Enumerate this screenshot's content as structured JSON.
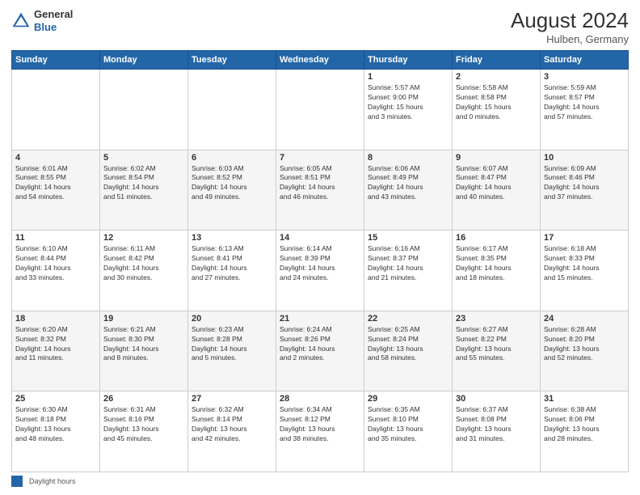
{
  "header": {
    "title": "August 2024",
    "location": "Hulben, Germany",
    "logo_general": "General",
    "logo_blue": "Blue"
  },
  "days_of_week": [
    "Sunday",
    "Monday",
    "Tuesday",
    "Wednesday",
    "Thursday",
    "Friday",
    "Saturday"
  ],
  "footer": {
    "legend_label": "Daylight hours"
  },
  "weeks": [
    {
      "days": [
        {
          "num": "",
          "info": ""
        },
        {
          "num": "",
          "info": ""
        },
        {
          "num": "",
          "info": ""
        },
        {
          "num": "",
          "info": ""
        },
        {
          "num": "1",
          "info": "Sunrise: 5:57 AM\nSunset: 9:00 PM\nDaylight: 15 hours\nand 3 minutes."
        },
        {
          "num": "2",
          "info": "Sunrise: 5:58 AM\nSunset: 8:58 PM\nDaylight: 15 hours\nand 0 minutes."
        },
        {
          "num": "3",
          "info": "Sunrise: 5:59 AM\nSunset: 8:57 PM\nDaylight: 14 hours\nand 57 minutes."
        }
      ]
    },
    {
      "days": [
        {
          "num": "4",
          "info": "Sunrise: 6:01 AM\nSunset: 8:55 PM\nDaylight: 14 hours\nand 54 minutes."
        },
        {
          "num": "5",
          "info": "Sunrise: 6:02 AM\nSunset: 8:54 PM\nDaylight: 14 hours\nand 51 minutes."
        },
        {
          "num": "6",
          "info": "Sunrise: 6:03 AM\nSunset: 8:52 PM\nDaylight: 14 hours\nand 49 minutes."
        },
        {
          "num": "7",
          "info": "Sunrise: 6:05 AM\nSunset: 8:51 PM\nDaylight: 14 hours\nand 46 minutes."
        },
        {
          "num": "8",
          "info": "Sunrise: 6:06 AM\nSunset: 8:49 PM\nDaylight: 14 hours\nand 43 minutes."
        },
        {
          "num": "9",
          "info": "Sunrise: 6:07 AM\nSunset: 8:47 PM\nDaylight: 14 hours\nand 40 minutes."
        },
        {
          "num": "10",
          "info": "Sunrise: 6:09 AM\nSunset: 8:46 PM\nDaylight: 14 hours\nand 37 minutes."
        }
      ]
    },
    {
      "days": [
        {
          "num": "11",
          "info": "Sunrise: 6:10 AM\nSunset: 8:44 PM\nDaylight: 14 hours\nand 33 minutes."
        },
        {
          "num": "12",
          "info": "Sunrise: 6:11 AM\nSunset: 8:42 PM\nDaylight: 14 hours\nand 30 minutes."
        },
        {
          "num": "13",
          "info": "Sunrise: 6:13 AM\nSunset: 8:41 PM\nDaylight: 14 hours\nand 27 minutes."
        },
        {
          "num": "14",
          "info": "Sunrise: 6:14 AM\nSunset: 8:39 PM\nDaylight: 14 hours\nand 24 minutes."
        },
        {
          "num": "15",
          "info": "Sunrise: 6:16 AM\nSunset: 8:37 PM\nDaylight: 14 hours\nand 21 minutes."
        },
        {
          "num": "16",
          "info": "Sunrise: 6:17 AM\nSunset: 8:35 PM\nDaylight: 14 hours\nand 18 minutes."
        },
        {
          "num": "17",
          "info": "Sunrise: 6:18 AM\nSunset: 8:33 PM\nDaylight: 14 hours\nand 15 minutes."
        }
      ]
    },
    {
      "days": [
        {
          "num": "18",
          "info": "Sunrise: 6:20 AM\nSunset: 8:32 PM\nDaylight: 14 hours\nand 11 minutes."
        },
        {
          "num": "19",
          "info": "Sunrise: 6:21 AM\nSunset: 8:30 PM\nDaylight: 14 hours\nand 8 minutes."
        },
        {
          "num": "20",
          "info": "Sunrise: 6:23 AM\nSunset: 8:28 PM\nDaylight: 14 hours\nand 5 minutes."
        },
        {
          "num": "21",
          "info": "Sunrise: 6:24 AM\nSunset: 8:26 PM\nDaylight: 14 hours\nand 2 minutes."
        },
        {
          "num": "22",
          "info": "Sunrise: 6:25 AM\nSunset: 8:24 PM\nDaylight: 13 hours\nand 58 minutes."
        },
        {
          "num": "23",
          "info": "Sunrise: 6:27 AM\nSunset: 8:22 PM\nDaylight: 13 hours\nand 55 minutes."
        },
        {
          "num": "24",
          "info": "Sunrise: 6:28 AM\nSunset: 8:20 PM\nDaylight: 13 hours\nand 52 minutes."
        }
      ]
    },
    {
      "days": [
        {
          "num": "25",
          "info": "Sunrise: 6:30 AM\nSunset: 8:18 PM\nDaylight: 13 hours\nand 48 minutes."
        },
        {
          "num": "26",
          "info": "Sunrise: 6:31 AM\nSunset: 8:16 PM\nDaylight: 13 hours\nand 45 minutes."
        },
        {
          "num": "27",
          "info": "Sunrise: 6:32 AM\nSunset: 8:14 PM\nDaylight: 13 hours\nand 42 minutes."
        },
        {
          "num": "28",
          "info": "Sunrise: 6:34 AM\nSunset: 8:12 PM\nDaylight: 13 hours\nand 38 minutes."
        },
        {
          "num": "29",
          "info": "Sunrise: 6:35 AM\nSunset: 8:10 PM\nDaylight: 13 hours\nand 35 minutes."
        },
        {
          "num": "30",
          "info": "Sunrise: 6:37 AM\nSunset: 8:08 PM\nDaylight: 13 hours\nand 31 minutes."
        },
        {
          "num": "31",
          "info": "Sunrise: 6:38 AM\nSunset: 8:06 PM\nDaylight: 13 hours\nand 28 minutes."
        }
      ]
    }
  ]
}
